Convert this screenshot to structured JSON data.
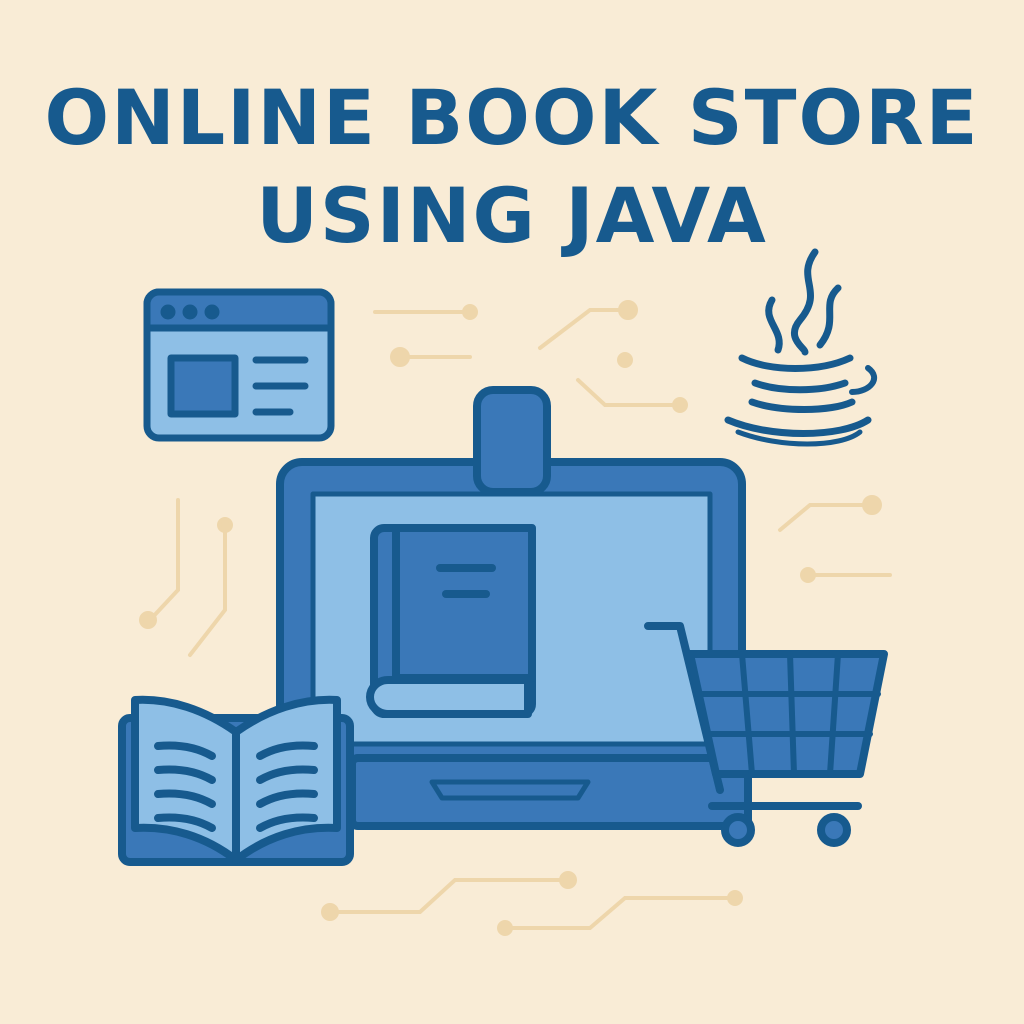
{
  "title": {
    "line1": "ONLINE BOOK STORE",
    "line2": "USING JAVA"
  },
  "icons": [
    "browser-window-icon",
    "java-logo-icon",
    "laptop-icon",
    "book-icon",
    "open-book-icon",
    "shopping-cart-icon",
    "circuit-lines-decoration"
  ],
  "colors": {
    "background": "#f9ecd6",
    "outline": "#175a8e",
    "fill_mid": "#3a78b8",
    "fill_light": "#8ebfe6",
    "circuit": "#eed6ab"
  }
}
